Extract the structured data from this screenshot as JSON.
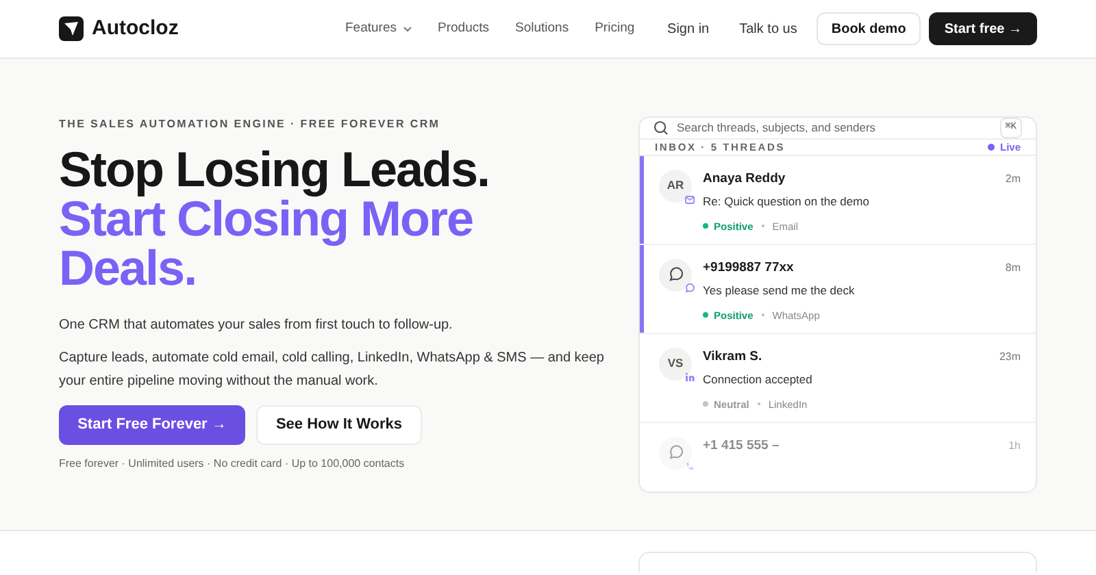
{
  "brand": {
    "name": "Autocloz"
  },
  "nav": [
    {
      "label": "Features",
      "dropdown": true
    },
    {
      "label": "Products",
      "dropdown": false
    },
    {
      "label": "Solutions",
      "dropdown": false
    },
    {
      "label": "Pricing",
      "dropdown": false
    }
  ],
  "header_actions": {
    "sign_in": "Sign in",
    "talk": "Talk to us",
    "book_demo": "Book demo",
    "start": "Start free →"
  },
  "hero": {
    "eyebrow": "THE SALES AUTOMATION ENGINE · FREE FOREVER CRM",
    "headline_1": "Stop Losing Leads.",
    "headline_2": "Start Closing More Deals.",
    "lead": "One CRM that automates your sales from first touch to follow-up.",
    "body": "Capture leads, automate cold email, cold calling, LinkedIn, WhatsApp & SMS — and keep your entire pipeline moving without the manual work.",
    "primary_button": "Start Free Forever →",
    "secondary_button": "See How It Works",
    "footnote": "Free forever · Unlimited users · No credit card · Up to 100,000 contacts"
  },
  "inbox": {
    "search": {
      "placeholder": "Search threads, subjects, and senders",
      "shortcut": "⌘K"
    },
    "heading": "INBOX · 5 THREADS",
    "live": "Live",
    "threads": [
      {
        "avatar": {
          "kind": "initials",
          "initials": "AR"
        },
        "channel_icon": {
          "kind": "email"
        },
        "name": "Anaya Reddy",
        "time": "2m",
        "subject": "Re: Quick question on the demo",
        "sentiment": {
          "label": "Positive",
          "color": "#10b981"
        },
        "channel": "Email",
        "selected": true,
        "faded": false
      },
      {
        "avatar": {
          "kind": "chat"
        },
        "channel_icon": {
          "kind": "whatsapp"
        },
        "name": "+9199887 77xx",
        "time": "8m",
        "subject": "Yes please send me the deck",
        "sentiment": {
          "label": "Positive",
          "color": "#10b981"
        },
        "channel": "WhatsApp",
        "selected": true,
        "faded": false
      },
      {
        "avatar": {
          "kind": "initials",
          "initials": "VS"
        },
        "channel_icon": {
          "kind": "linkedin"
        },
        "name": "Vikram S.",
        "time": "23m",
        "subject": "Connection accepted",
        "sentiment": {
          "label": "Neutral",
          "color": "#c4c4c4"
        },
        "channel": "LinkedIn",
        "selected": false,
        "faded": false
      },
      {
        "avatar": {
          "kind": "chat"
        },
        "channel_icon": {
          "kind": "phone"
        },
        "name": "+1 415 555 –",
        "time": "1h",
        "selected": false,
        "faded": true
      }
    ]
  }
}
